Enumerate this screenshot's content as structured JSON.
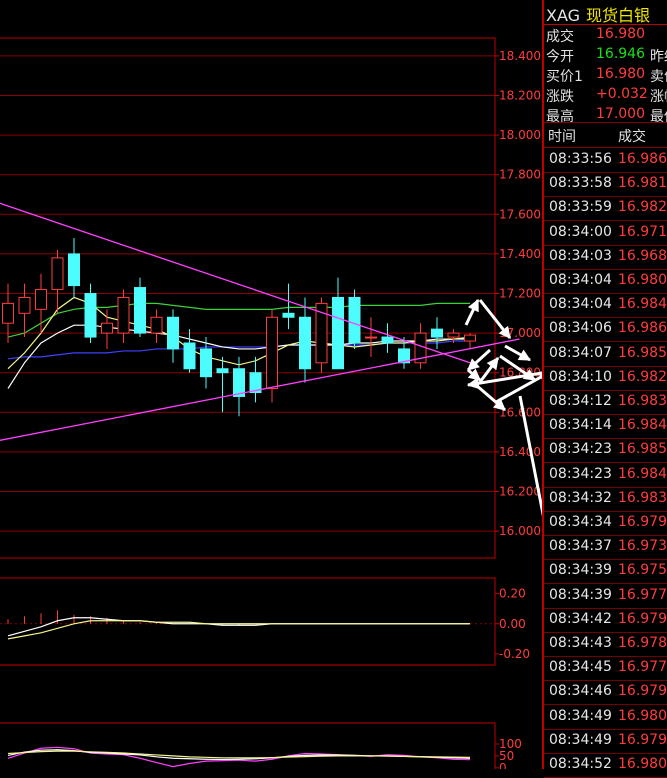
{
  "colors": {
    "background": "#000000",
    "grid": "#8b0000",
    "axis": "#c00000",
    "up": "#ff3c3c",
    "down": "#4dfcfc",
    "price_text": "#ff3c3c",
    "trendline": "#ff40ff",
    "ma_yellow": "#f5f58c",
    "ma_green": "#3cd23c",
    "ma_blue": "#4040ff",
    "macd_white": "#ffffff",
    "arrow": "#ffffff"
  },
  "header": {
    "symbol": "XAG",
    "name": "现货白银"
  },
  "quote": [
    {
      "label": "成交",
      "value": "16.980",
      "color": "red",
      "label2": ""
    },
    {
      "label": "今开",
      "value": "16.946",
      "color": "green",
      "label2": "昨结"
    },
    {
      "label": "买价1",
      "value": "16.980",
      "color": "red",
      "label2": "卖价"
    },
    {
      "label": "涨跌",
      "value": "+0.032",
      "color": "red",
      "label2": "涨幅"
    },
    {
      "label": "最高",
      "value": "17.000",
      "color": "red",
      "label2": "最低"
    }
  ],
  "trades_header": {
    "time": "时间",
    "price": "成交"
  },
  "trades": [
    {
      "time": "08:33:56",
      "price": "16.986"
    },
    {
      "time": "08:33:58",
      "price": "16.981"
    },
    {
      "time": "08:33:59",
      "price": "16.982"
    },
    {
      "time": "08:34:00",
      "price": "16.971"
    },
    {
      "time": "08:34:03",
      "price": "16.968"
    },
    {
      "time": "08:34:04",
      "price": "16.980"
    },
    {
      "time": "08:34:04",
      "price": "16.984"
    },
    {
      "time": "08:34:06",
      "price": "16.986"
    },
    {
      "time": "08:34:07",
      "price": "16.985"
    },
    {
      "time": "08:34:10",
      "price": "16.982"
    },
    {
      "time": "08:34:12",
      "price": "16.983"
    },
    {
      "time": "08:34:14",
      "price": "16.984"
    },
    {
      "time": "08:34:23",
      "price": "16.985"
    },
    {
      "time": "08:34:23",
      "price": "16.984"
    },
    {
      "time": "08:34:32",
      "price": "16.983"
    },
    {
      "time": "08:34:34",
      "price": "16.979"
    },
    {
      "time": "08:34:37",
      "price": "16.973"
    },
    {
      "time": "08:34:39",
      "price": "16.975"
    },
    {
      "time": "08:34:39",
      "price": "16.977"
    },
    {
      "time": "08:34:42",
      "price": "16.979"
    },
    {
      "time": "08:34:43",
      "price": "16.978"
    },
    {
      "time": "08:34:45",
      "price": "16.977"
    },
    {
      "time": "08:34:46",
      "price": "16.979"
    },
    {
      "time": "08:34:49",
      "price": "16.980"
    },
    {
      "time": "08:34:49",
      "price": "16.979"
    },
    {
      "time": "08:34:52",
      "price": "16.980"
    }
  ],
  "chart_data": [
    {
      "type": "candlestick",
      "ylim": [
        15.95,
        18.45
      ],
      "yticks": [
        16.0,
        16.2,
        16.4,
        16.6,
        16.8,
        17.0,
        17.2,
        17.4,
        17.6,
        17.8,
        18.0,
        18.2,
        18.4
      ],
      "ytick_labels": [
        "16.000",
        "16.200",
        "16.400",
        "16.600",
        "16.800",
        "17.000",
        "17.200",
        "17.400",
        "17.600",
        "17.800",
        "18.000",
        "18.200",
        "18.400"
      ],
      "candles": [
        {
          "o": 17.05,
          "h": 17.25,
          "l": 16.95,
          "c": 17.15
        },
        {
          "o": 17.1,
          "h": 17.25,
          "l": 16.98,
          "c": 17.18
        },
        {
          "o": 17.12,
          "h": 17.3,
          "l": 17.0,
          "c": 17.22
        },
        {
          "o": 17.22,
          "h": 17.42,
          "l": 17.1,
          "c": 17.38
        },
        {
          "o": 17.4,
          "h": 17.48,
          "l": 17.18,
          "c": 17.24
        },
        {
          "o": 17.2,
          "h": 17.25,
          "l": 16.95,
          "c": 16.98
        },
        {
          "o": 17.0,
          "h": 17.12,
          "l": 16.92,
          "c": 17.05
        },
        {
          "o": 17.0,
          "h": 17.22,
          "l": 16.95,
          "c": 17.18
        },
        {
          "o": 17.23,
          "h": 17.28,
          "l": 16.98,
          "c": 17.0
        },
        {
          "o": 17.0,
          "h": 17.12,
          "l": 16.95,
          "c": 17.08
        },
        {
          "o": 17.08,
          "h": 17.12,
          "l": 16.85,
          "c": 16.92
        },
        {
          "o": 16.95,
          "h": 17.02,
          "l": 16.8,
          "c": 16.82
        },
        {
          "o": 16.92,
          "h": 16.98,
          "l": 16.72,
          "c": 16.78
        },
        {
          "o": 16.82,
          "h": 16.88,
          "l": 16.6,
          "c": 16.8
        },
        {
          "o": 16.82,
          "h": 16.88,
          "l": 16.58,
          "c": 16.68
        },
        {
          "o": 16.8,
          "h": 16.88,
          "l": 16.65,
          "c": 16.7
        },
        {
          "o": 16.72,
          "h": 17.12,
          "l": 16.65,
          "c": 17.08
        },
        {
          "o": 17.1,
          "h": 17.25,
          "l": 17.02,
          "c": 17.08
        },
        {
          "o": 17.08,
          "h": 17.18,
          "l": 16.75,
          "c": 16.82
        },
        {
          "o": 16.85,
          "h": 17.18,
          "l": 16.8,
          "c": 17.15
        },
        {
          "o": 17.18,
          "h": 17.28,
          "l": 16.82,
          "c": 16.82
        },
        {
          "o": 17.18,
          "h": 17.22,
          "l": 16.92,
          "c": 16.95
        },
        {
          "o": 16.98,
          "h": 17.08,
          "l": 16.88,
          "c": 16.98
        },
        {
          "o": 16.98,
          "h": 17.05,
          "l": 16.9,
          "c": 16.95
        },
        {
          "o": 16.92,
          "h": 16.98,
          "l": 16.82,
          "c": 16.85
        },
        {
          "o": 16.85,
          "h": 17.05,
          "l": 16.82,
          "c": 17.0
        },
        {
          "o": 17.02,
          "h": 17.08,
          "l": 16.92,
          "c": 16.98
        },
        {
          "o": 16.98,
          "h": 17.02,
          "l": 16.95,
          "c": 17.0
        },
        {
          "o": 16.96,
          "h": 17.0,
          "l": 16.92,
          "c": 16.99
        }
      ],
      "ma_yellow": [
        16.82,
        16.9,
        17.0,
        17.12,
        17.18,
        17.15,
        17.08,
        17.06,
        17.04,
        17.02,
        16.98,
        16.92,
        16.88,
        16.86,
        16.84,
        16.86,
        16.9,
        16.94,
        16.96,
        16.95,
        16.94,
        16.93,
        16.94,
        16.95,
        16.95,
        16.96,
        16.96,
        16.97,
        16.98
      ],
      "ma_green": [
        16.98,
        17.0,
        17.05,
        17.1,
        17.12,
        17.13,
        17.13,
        17.14,
        17.15,
        17.15,
        17.14,
        17.13,
        17.12,
        17.12,
        17.12,
        17.12,
        17.12,
        17.13,
        17.13,
        17.13,
        17.13,
        17.14,
        17.14,
        17.14,
        17.14,
        17.14,
        17.15,
        17.15,
        17.15
      ],
      "ma_blue": [
        16.87,
        16.88,
        16.88,
        16.89,
        16.9,
        16.9,
        16.9,
        16.91,
        16.91,
        16.92,
        16.92,
        16.92,
        16.93,
        16.93,
        16.93,
        16.93,
        16.93,
        16.94,
        16.94,
        16.94,
        16.94,
        16.94,
        16.94,
        16.95,
        16.95,
        16.95,
        16.95,
        16.96,
        16.96
      ],
      "ma_white": [
        16.72,
        16.85,
        16.95,
        17.0,
        17.04,
        17.04,
        17.03,
        17.02,
        17.01,
        17.0,
        16.99,
        16.97,
        16.95,
        16.93,
        16.92,
        16.92,
        16.93,
        16.94,
        16.94,
        16.94,
        16.94,
        16.95,
        16.95,
        16.96,
        16.96,
        16.96,
        16.97,
        16.97,
        16.97
      ],
      "trendlines": [
        {
          "from": [
            -1,
            17.67
          ],
          "to": [
            28,
            16.85
          ]
        },
        {
          "from": [
            -1,
            16.45
          ],
          "to": [
            31,
            16.97
          ]
        }
      ]
    },
    {
      "type": "line",
      "ylim": [
        -0.24,
        0.29
      ],
      "yticks": [
        0.2,
        0.0,
        -0.2
      ],
      "ytick_labels": [
        "0.20",
        "0.00",
        "-0.20"
      ],
      "series": [
        {
          "color": "#ffffff",
          "values": [
            -0.08,
            -0.05,
            -0.02,
            0.02,
            0.04,
            0.04,
            0.03,
            0.02,
            0.02,
            0.01,
            0.0,
            0.0,
            0.0,
            -0.01,
            -0.01,
            -0.01,
            0.0,
            0.0,
            0.0,
            0.0,
            0.0,
            0.0,
            0.0,
            0.0,
            0.0,
            0.0,
            0.0,
            0.0,
            0.0
          ]
        },
        {
          "color": "#f5f58c",
          "values": [
            -0.1,
            -0.08,
            -0.06,
            -0.03,
            0.0,
            0.02,
            0.02,
            0.02,
            0.02,
            0.01,
            0.01,
            0.01,
            0.0,
            0.0,
            0.0,
            0.0,
            0.0,
            0.0,
            0.0,
            0.0,
            0.0,
            0.0,
            0.0,
            0.0,
            0.0,
            0.0,
            0.0,
            0.0,
            0.0
          ]
        }
      ],
      "histogram": [
        0.03,
        0.05,
        0.07,
        0.09,
        0.06,
        0.05,
        0.04,
        0.02,
        0.01,
        0.01,
        0.0,
        0.0,
        0.0,
        -0.01,
        -0.01,
        0.0,
        0.0,
        0.0,
        0.0,
        0.0,
        0.0,
        0.0,
        0.0,
        0.0,
        0.0,
        0.0,
        0.0,
        0.0,
        0.0
      ]
    },
    {
      "type": "line",
      "ylim": [
        -5,
        125
      ],
      "yticks": [
        100,
        50,
        0
      ],
      "ytick_labels": [
        "100",
        "50",
        "0"
      ],
      "series": [
        {
          "color": "#ff40ff",
          "values": [
            40,
            62,
            82,
            86,
            80,
            62,
            58,
            55,
            40,
            22,
            5,
            18,
            28,
            30,
            32,
            28,
            36,
            50,
            60,
            58,
            55,
            52,
            48,
            55,
            52,
            46,
            42,
            36,
            34
          ]
        },
        {
          "color": "#ffffff",
          "values": [
            52,
            66,
            74,
            76,
            72,
            64,
            62,
            58,
            54,
            46,
            40,
            38,
            36,
            35,
            36,
            38,
            42,
            48,
            52,
            54,
            54,
            52,
            50,
            50,
            48,
            46,
            44,
            42,
            40
          ]
        },
        {
          "color": "#f5f58c",
          "values": [
            60,
            64,
            68,
            70,
            70,
            67,
            65,
            62,
            58,
            54,
            50,
            46,
            44,
            42,
            42,
            42,
            43,
            45,
            47,
            49,
            50,
            50,
            50,
            49,
            48,
            47,
            46,
            45,
            44
          ]
        }
      ]
    }
  ]
}
